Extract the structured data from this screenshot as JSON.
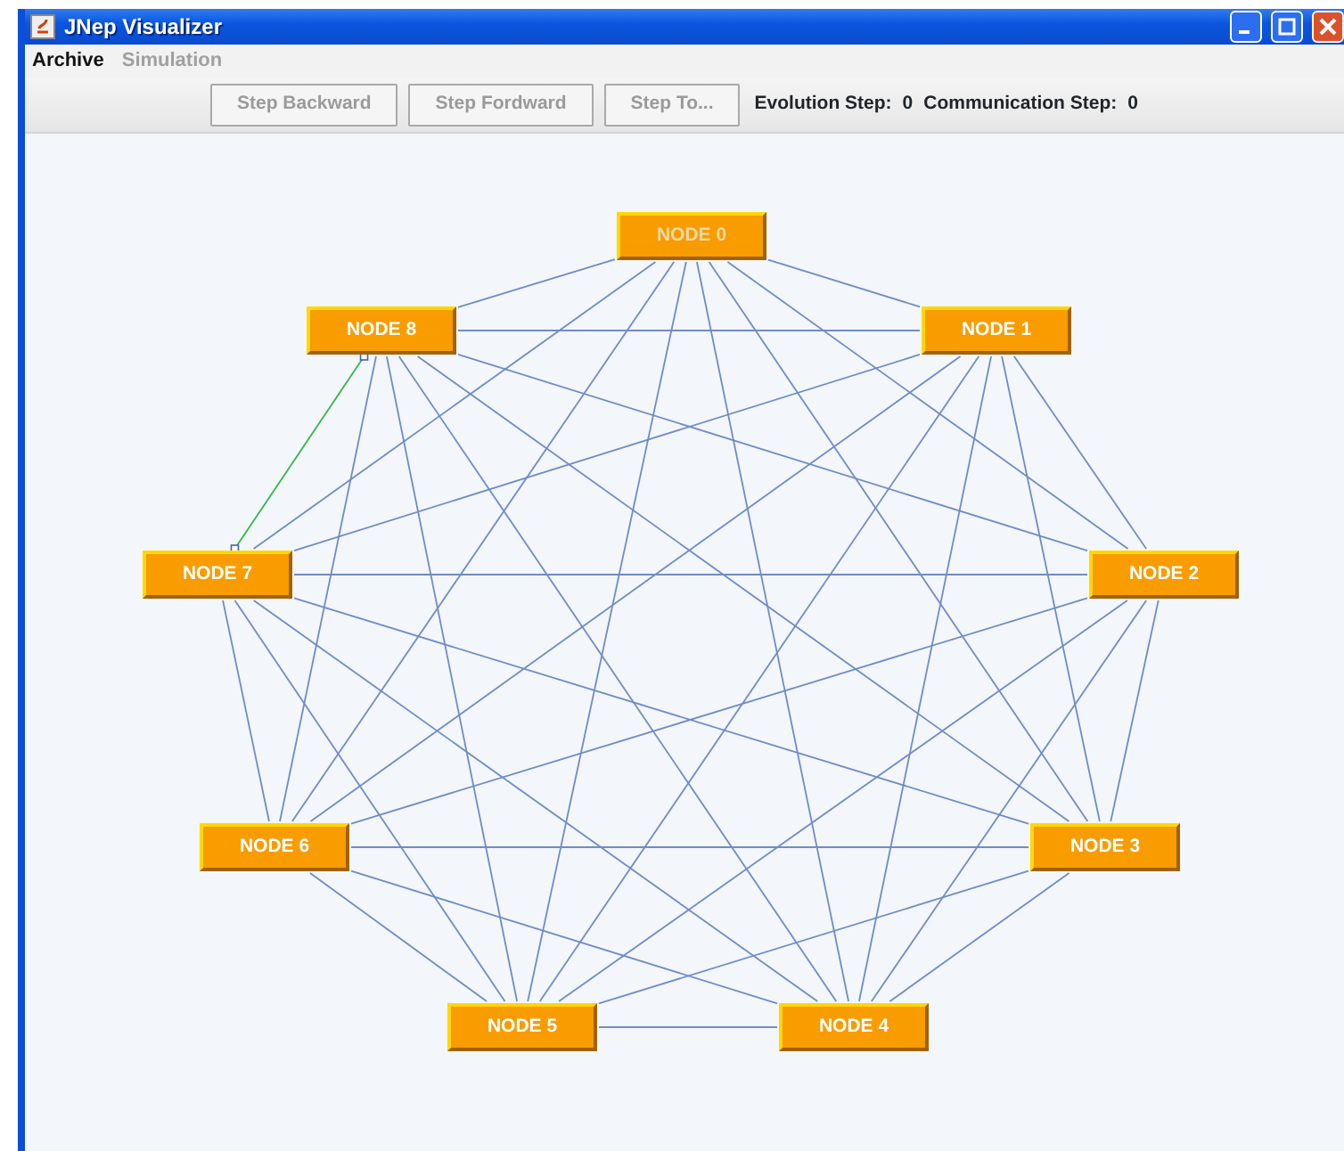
{
  "window": {
    "title": "JNep Visualizer"
  },
  "menu": [
    {
      "label": "Archive",
      "disabled": false
    },
    {
      "label": "Simulation",
      "disabled": true
    }
  ],
  "toolbar": {
    "buttons": [
      {
        "label": "Step Backward",
        "disabled": true
      },
      {
        "label": "Step Fordward",
        "disabled": true
      },
      {
        "label": "Step To...",
        "disabled": true
      }
    ],
    "evolution_label": "Evolution Step:",
    "evolution_value": "0",
    "communication_label": "Communication Step:",
    "communication_value": "0"
  },
  "graph": {
    "nodes": [
      {
        "label": "NODE 0",
        "disabled": true,
        "edge_selected": false
      },
      {
        "label": "NODE 1",
        "disabled": false,
        "edge_selected": false
      },
      {
        "label": "NODE 2",
        "disabled": false,
        "edge_selected": false
      },
      {
        "label": "NODE 3",
        "disabled": false,
        "edge_selected": false
      },
      {
        "label": "NODE 4",
        "disabled": false,
        "edge_selected": false
      },
      {
        "label": "NODE 5",
        "disabled": false,
        "edge_selected": false
      },
      {
        "label": "NODE 6",
        "disabled": false,
        "edge_selected": false
      },
      {
        "label": "NODE 7",
        "disabled": false,
        "edge_selected": true
      },
      {
        "label": "NODE 8",
        "disabled": false,
        "edge_selected": true
      }
    ]
  }
}
